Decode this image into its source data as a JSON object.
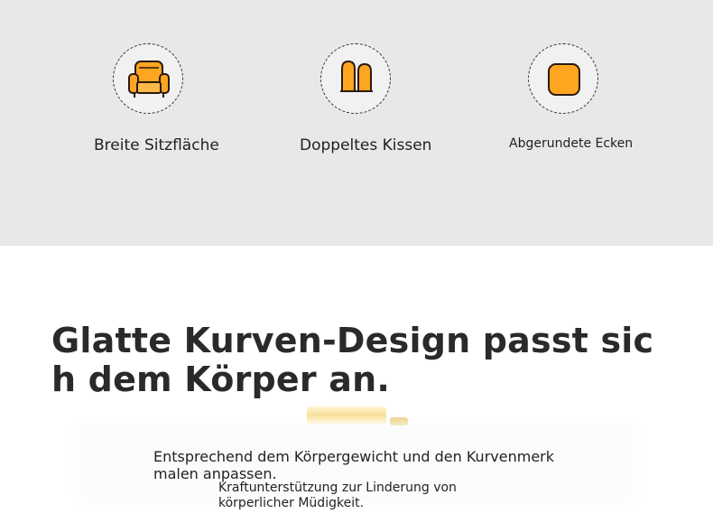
{
  "features": [
    {
      "icon": "armchair-icon",
      "label": "Breite Sitzfläche"
    },
    {
      "icon": "double-cushion-icon",
      "label": "Doppeltes Kissen"
    },
    {
      "icon": "rounded-corner-icon",
      "label": "Abgerundete Ecken"
    }
  ],
  "colors": {
    "features_background": "#e8e8e8",
    "icon_orange": "#ffa51f",
    "icon_outline": "#2a1a10",
    "text": "#1f1f1f"
  },
  "headline": "Glatte Kurven-Design passt sich dem Körper an.",
  "description": "Entsprechend dem Körpergewicht und den Kurvenmerkmalen anpassen.",
  "subdescription": "Kraftunterstützung zur Linderung von körperlicher Müdigkeit."
}
